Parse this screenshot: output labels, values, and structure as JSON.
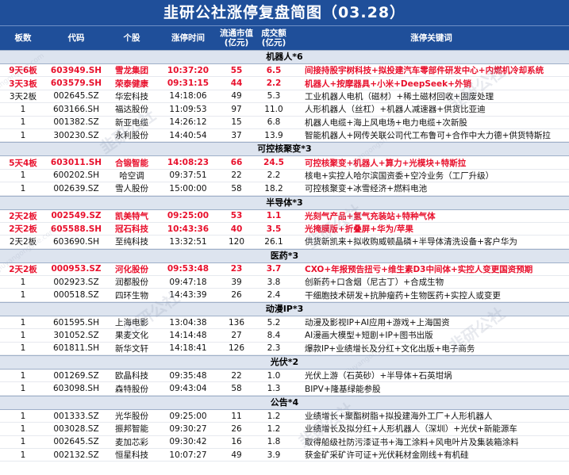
{
  "title": "韭研公社涨停复盘简图（03.28）",
  "headers": [
    "板数",
    "代码",
    "个股",
    "涨停时间",
    "流通市值\n(亿元)",
    "成交额\n(亿元)",
    "涨停关键词"
  ],
  "watermark": "韭研公社",
  "watermark_url": "jiuyangongshe.com",
  "sections": [
    {
      "name": "机器人*6",
      "rows": [
        {
          "board": "9天6板",
          "code": "603949.SH",
          "name": "雪龙集团",
          "time": "10:37:20",
          "mcap": "55",
          "vol": "6.5",
          "keywords": "间接持股宇树科技+拟投建汽车零部件研发中心+内燃机冷却系统",
          "hl": true
        },
        {
          "board": "3天3板",
          "code": "603579.SH",
          "name": "荣泰健康",
          "time": "09:31:15",
          "mcap": "44",
          "vol": "2.2",
          "keywords": "机器人+按摩器具+小米+DeepSeek+外销",
          "hl": true
        },
        {
          "board": "3天2板",
          "code": "002645.SZ",
          "name": "华宏科技",
          "time": "14:18:06",
          "mcap": "49",
          "vol": "5.3",
          "keywords": "工业机器人电机（磁材）+稀土磁材回收+固废处理",
          "hl": false
        },
        {
          "board": "1",
          "code": "603166.SH",
          "name": "福达股份",
          "time": "11:09:53",
          "mcap": "97",
          "vol": "11.0",
          "keywords": "人形机器人（丝杠）+机器人减速器+供货比亚迪",
          "hl": false
        },
        {
          "board": "1",
          "code": "001382.SZ",
          "name": "新亚电缆",
          "time": "14:26:12",
          "mcap": "15",
          "vol": "6.8",
          "keywords": "机器人电缆+海上风电场+电力电缆+次新股",
          "hl": false
        },
        {
          "board": "1",
          "code": "300230.SZ",
          "name": "永利股份",
          "time": "14:40:54",
          "mcap": "37",
          "vol": "13.9",
          "keywords": "智能机器人+网传关联公司代工布鲁可+合作中大力德+供货特斯拉",
          "hl": false
        }
      ]
    },
    {
      "name": "可控核聚变*3",
      "rows": [
        {
          "board": "5天4板",
          "code": "603011.SH",
          "name": "合锻智能",
          "time": "14:08:23",
          "mcap": "66",
          "vol": "24.5",
          "keywords": "可控核聚变+机器人+算力+光模块+特斯拉",
          "hl": true
        },
        {
          "board": "1",
          "code": "600202.SH",
          "name": "哈空调",
          "time": "09:37:51",
          "mcap": "22",
          "vol": "2.2",
          "keywords": "核电+实控人哈尔滨国资委+空冷业务（工厂升级）",
          "hl": false
        },
        {
          "board": "1",
          "code": "002639.SZ",
          "name": "雪人股份",
          "time": "15:00:00",
          "mcap": "58",
          "vol": "18.2",
          "keywords": "可控核聚变+冰雪经济+燃料电池",
          "hl": false
        }
      ]
    },
    {
      "name": "半导体*3",
      "rows": [
        {
          "board": "2天2板",
          "code": "002549.SZ",
          "name": "凯美特气",
          "time": "09:25:00",
          "mcap": "53",
          "vol": "1.1",
          "keywords": "光刻气产品+氢气充装站+特种气体",
          "hl": true
        },
        {
          "board": "2天2板",
          "code": "605588.SH",
          "name": "冠石科技",
          "time": "10:43:36",
          "mcap": "40",
          "vol": "3.5",
          "keywords": "光掩膜版+折叠屏+华为/苹果",
          "hl": true
        },
        {
          "board": "2天2板",
          "code": "603690.SH",
          "name": "至纯科技",
          "time": "13:32:51",
          "mcap": "120",
          "vol": "26.1",
          "keywords": "供货新凯来+拟收购威顿晶磷+半导体清洗设备+客户华为",
          "hl": false
        }
      ]
    },
    {
      "name": "医药*3",
      "rows": [
        {
          "board": "2天2板",
          "code": "000953.SZ",
          "name": "河化股份",
          "time": "09:53:48",
          "mcap": "23",
          "vol": "3.7",
          "keywords": "CXO+年报预告扭亏+维生素D3中间体+实控人变更国资预期",
          "hl": true
        },
        {
          "board": "1",
          "code": "002923.SZ",
          "name": "润都股份",
          "time": "09:47:18",
          "mcap": "39",
          "vol": "3.8",
          "keywords": "创新药+口含烟（尼古丁）+合成生物",
          "hl": false
        },
        {
          "board": "1",
          "code": "000518.SZ",
          "name": "四环生物",
          "time": "14:43:39",
          "mcap": "26",
          "vol": "2.4",
          "keywords": "干细胞技术研发+抗肿瘤药+生物医药+实控人或变更",
          "hl": false
        }
      ]
    },
    {
      "name": "动漫IP*3",
      "rows": [
        {
          "board": "1",
          "code": "601595.SH",
          "name": "上海电影",
          "time": "13:04:38",
          "mcap": "136",
          "vol": "5.2",
          "keywords": "动漫及影视IP+AI应用+游戏+上海国资",
          "hl": false
        },
        {
          "board": "1",
          "code": "301052.SZ",
          "name": "果麦文化",
          "time": "14:14:48",
          "mcap": "27",
          "vol": "8.4",
          "keywords": "AI漫画大模型+短剧+IP+图书出版",
          "hl": false
        },
        {
          "board": "1",
          "code": "601811.SH",
          "name": "新华文轩",
          "time": "14:18:41",
          "mcap": "126",
          "vol": "2.3",
          "keywords": "爆款IP+业绩增长及分红+文化出版+电子商务",
          "hl": false
        }
      ]
    },
    {
      "name": "光伏*2",
      "rows": [
        {
          "board": "1",
          "code": "001269.SZ",
          "name": "欧晶科技",
          "time": "09:35:48",
          "mcap": "22",
          "vol": "1.0",
          "keywords": "光伏上游（石英砂）+半导体+石英坩埚",
          "hl": false
        },
        {
          "board": "1",
          "code": "603098.SH",
          "name": "森特股份",
          "time": "09:43:04",
          "mcap": "58",
          "vol": "1.3",
          "keywords": "BIPV+隆基绿能参股",
          "hl": false
        }
      ]
    },
    {
      "name": "公告*4",
      "rows": [
        {
          "board": "1",
          "code": "001333.SZ",
          "name": "光华股份",
          "time": "09:25:00",
          "mcap": "11",
          "vol": "1.2",
          "keywords": "业绩增长+聚酯树脂+拟投建海外工厂+人形机器人",
          "hl": false
        },
        {
          "board": "1",
          "code": "003028.SZ",
          "name": "振邦智能",
          "time": "09:30:27",
          "mcap": "26",
          "vol": "1.2",
          "keywords": "业绩增长及拟分红+人形机器人（深圳）+光伏+新能源车",
          "hl": false
        },
        {
          "board": "1",
          "code": "002645.SZ",
          "name": "麦加芯彩",
          "time": "09:30:42",
          "mcap": "16",
          "vol": "1.8",
          "keywords": "取得船级社防污漆证书+海工涂料+风电叶片及集装箱涂料",
          "hl": false
        },
        {
          "board": "1",
          "code": "002132.SZ",
          "name": "恒星科技",
          "time": "10:07:27",
          "mcap": "49",
          "vol": "3.9",
          "keywords": "获金矿采矿许可证+光伏耗材金刚线+有机硅",
          "hl": false
        }
      ]
    }
  ]
}
